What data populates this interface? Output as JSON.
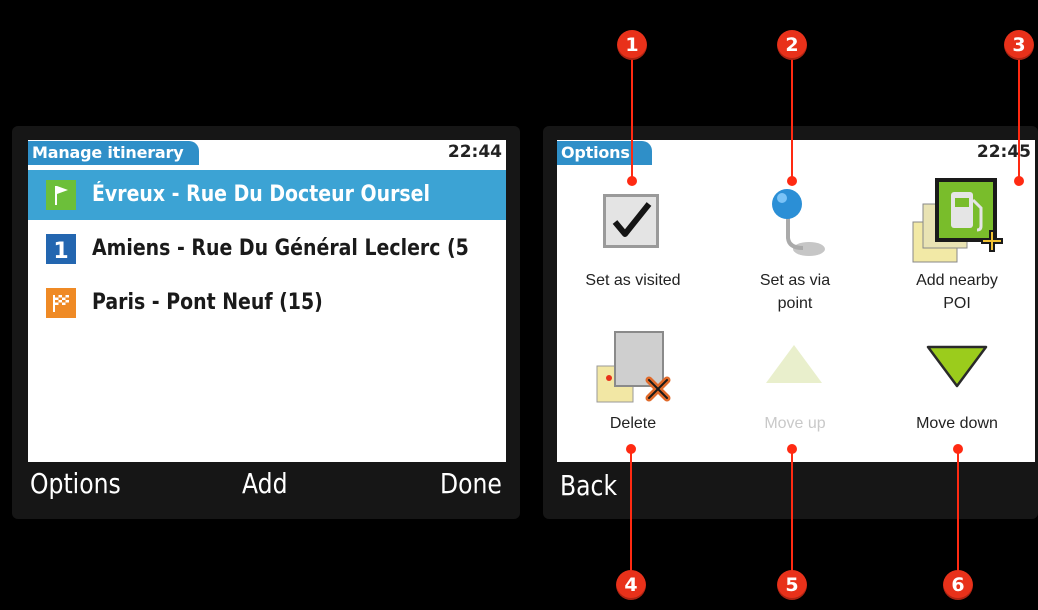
{
  "left_screen": {
    "title": "Manage itinerary",
    "clock": "22:44",
    "items": [
      {
        "label": "Évreux - Rue Du Docteur Oursel",
        "icon": "start-flag-icon",
        "selected": true
      },
      {
        "label": "Amiens - Rue Du Général Leclerc (5",
        "icon": "waypoint-1-icon",
        "badge": "1",
        "selected": false
      },
      {
        "label": "Paris - Pont Neuf (15)",
        "icon": "finish-flag-icon",
        "selected": false
      }
    ],
    "softkeys": {
      "left": "Options",
      "center": "Add",
      "right": "Done"
    }
  },
  "right_screen": {
    "title": "Options",
    "clock": "22:45",
    "options": [
      {
        "label": "Set as visited",
        "icon": "checkbox-check-icon",
        "enabled": true
      },
      {
        "label": "Set as via point",
        "icon": "via-point-pin-icon",
        "enabled": true
      },
      {
        "label": "Add nearby POI",
        "icon": "add-poi-fuel-icon",
        "enabled": true
      },
      {
        "label": "Delete",
        "icon": "delete-map-icon",
        "enabled": true
      },
      {
        "label": "Move up",
        "icon": "arrow-up-icon",
        "enabled": false
      },
      {
        "label": "Move down",
        "icon": "arrow-down-icon",
        "enabled": true
      }
    ],
    "softkeys": {
      "left": "Back"
    }
  },
  "callouts": [
    "1",
    "2",
    "3",
    "4",
    "5",
    "6"
  ],
  "colors": {
    "title_tab": "#2f8fc8",
    "selection": "#3ca3d4",
    "callout": "#e8311a",
    "start_flag": "#6cbf3a",
    "waypoint": "#2366b0",
    "finish_flag": "#ef8a25",
    "arrow_green": "#9bcc1c"
  }
}
